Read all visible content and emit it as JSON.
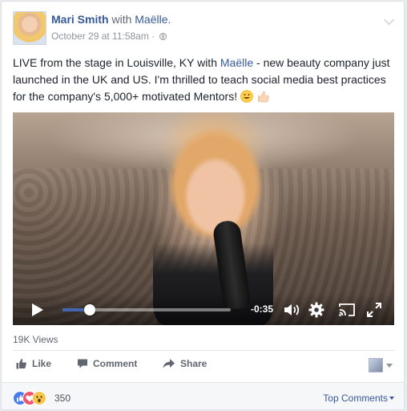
{
  "post": {
    "author": "Mari Smith",
    "with_word": "with",
    "tagged": "Maëlle.",
    "timestamp": "October 29 at 11:58am",
    "separator": "·",
    "text_before": "LIVE from the stage in Louisville, KY with ",
    "text_mention": "Maëlle",
    "text_after": " - new beauty company just launched in the UK and US. I'm thrilled to teach social media best practices for the company's 5,000+ motivated Mentors!"
  },
  "video": {
    "time_remaining": "-0:35",
    "progress": 0.16
  },
  "stats": {
    "views": "19K Views",
    "reaction_count": "350"
  },
  "actions": {
    "like": "Like",
    "comment": "Comment",
    "share": "Share"
  },
  "comments": {
    "sort_label": "Top Comments"
  },
  "icons": [
    "chevron-down-icon",
    "globe-icon",
    "grinning-emoji",
    "thumbs-up-emoji",
    "play-icon",
    "volume-icon",
    "gear-icon",
    "cast-icon",
    "fullscreen-icon",
    "like-icon",
    "comment-icon",
    "share-icon",
    "like-reaction-icon",
    "love-reaction-icon",
    "wow-reaction-icon"
  ],
  "colors": {
    "link": "#365899",
    "progress": "#4267b2",
    "muted": "#90949c"
  }
}
